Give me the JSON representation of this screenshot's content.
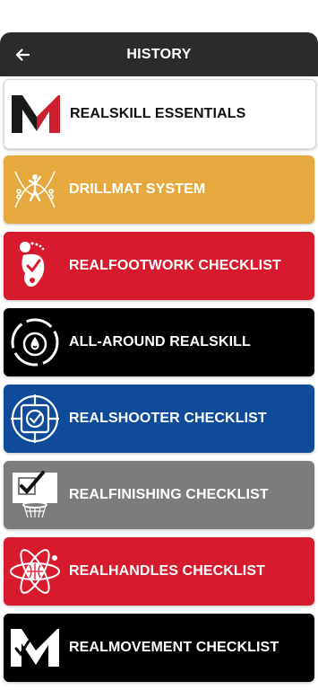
{
  "header": {
    "title": "HISTORY",
    "back_icon": "arrow-left-icon"
  },
  "items": [
    {
      "label": "REALSKILL ESSENTIALS",
      "bg": "#ffffff",
      "fg": "#111111",
      "icon": "realskill-m-logo-icon"
    },
    {
      "label": "DRILLMAT SYSTEM",
      "bg": "#e5a93f",
      "fg": "#ffffff",
      "icon": "drillmat-player-icon"
    },
    {
      "label": "REALFOOTWORK CHECKLIST",
      "bg": "#d71a2e",
      "fg": "#ffffff",
      "icon": "footprint-icon"
    },
    {
      "label": "ALL-AROUND REALSKILL",
      "bg": "#000000",
      "fg": "#ffffff",
      "icon": "drop-circle-icon"
    },
    {
      "label": "REALSHOOTER CHECKLIST",
      "bg": "#0f4b99",
      "fg": "#ffffff",
      "icon": "crosshair-target-icon"
    },
    {
      "label": "REALFINISHING CHECKLIST",
      "bg": "#7c7c7c",
      "fg": "#ffffff",
      "icon": "hoop-checkmark-icon"
    },
    {
      "label": "REALHANDLES CHECKLIST",
      "bg": "#d71a2e",
      "fg": "#ffffff",
      "icon": "atom-ball-icon"
    },
    {
      "label": "REALMOVEMENT CHECKLIST",
      "bg": "#000000",
      "fg": "#ffffff",
      "icon": "realskill-m-logo-icon"
    }
  ]
}
